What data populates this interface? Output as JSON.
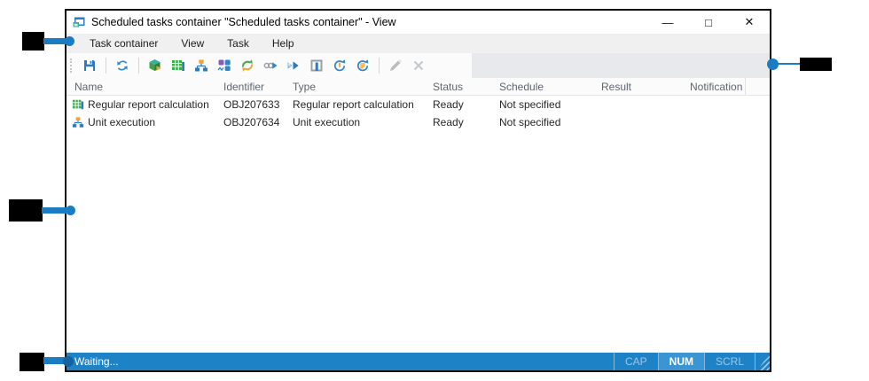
{
  "window": {
    "title": "Scheduled tasks container \"Scheduled tasks container\" - View",
    "controls": {
      "minimize": "—",
      "maximize": "□",
      "close": "✕"
    }
  },
  "menu": {
    "items": [
      "Task container",
      "View",
      "Task",
      "Help"
    ]
  },
  "toolbar": {
    "icons": [
      "save",
      "refresh",
      "cube-view",
      "report-table",
      "unit-orgchart",
      "monitor-blocks",
      "sync-cycle",
      "run-linked",
      "fast-forward",
      "container",
      "schedule-once",
      "schedule-list",
      "edit-disabled",
      "delete-disabled"
    ]
  },
  "table": {
    "columns": [
      "Name",
      "Identifier",
      "Type",
      "Status",
      "Schedule",
      "Result",
      "Notification"
    ],
    "rows": [
      {
        "icon": "report-table-icon",
        "name": "Regular report calculation",
        "identifier": "OBJ207633",
        "type": "Regular report calculation",
        "status": "Ready",
        "schedule": "Not specified",
        "result": "",
        "notification": ""
      },
      {
        "icon": "orgchart-icon",
        "name": "Unit execution",
        "identifier": "OBJ207634",
        "type": "Unit execution",
        "status": "Ready",
        "schedule": "Not specified",
        "result": "",
        "notification": ""
      }
    ]
  },
  "statusbar": {
    "text": "Waiting...",
    "indicators": [
      {
        "label": "CAP",
        "active": false
      },
      {
        "label": "NUM",
        "active": true
      },
      {
        "label": "SCRL",
        "active": false
      }
    ]
  },
  "colors": {
    "annotation_blue": "#1a7dc4",
    "statusbar_blue": "#1e82c6",
    "accent_blue": "#2e79c0"
  },
  "annotations": {
    "callouts": [
      {
        "id": "callout-menu-bar",
        "points_to": "menu-bar"
      },
      {
        "id": "callout-list-area",
        "points_to": "task-list-area"
      },
      {
        "id": "callout-toolbar-right",
        "points_to": "toolbar-area"
      },
      {
        "id": "callout-status-bar",
        "points_to": "status-bar"
      }
    ]
  }
}
